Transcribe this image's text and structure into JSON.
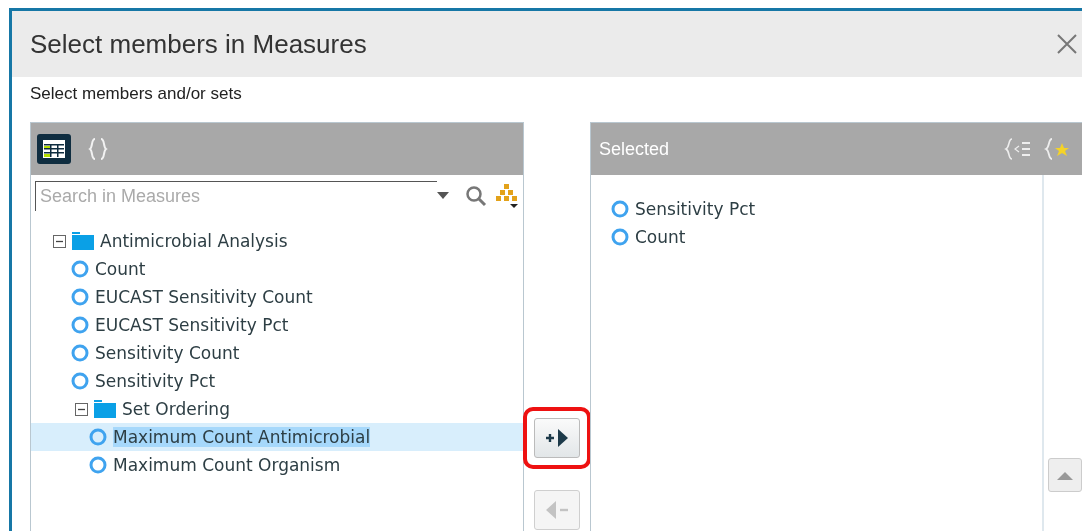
{
  "dialog": {
    "title": "Select members in Measures",
    "subtitle": "Select members and/or sets"
  },
  "left_panel": {
    "search": {
      "placeholder": "Search in Measures"
    },
    "tree": [
      {
        "kind": "folder",
        "label": "Antimicrobial Analysis",
        "expanded": true,
        "children": [
          {
            "kind": "member",
            "label": "Count",
            "selected": false
          },
          {
            "kind": "member",
            "label": "EUCAST Sensitivity Count",
            "selected": false
          },
          {
            "kind": "member",
            "label": "EUCAST Sensitivity Pct",
            "selected": false
          },
          {
            "kind": "member",
            "label": "Sensitivity Count",
            "selected": false
          },
          {
            "kind": "member",
            "label": "Sensitivity Pct",
            "selected": false
          },
          {
            "kind": "folder",
            "label": "Set Ordering",
            "expanded": true,
            "children": [
              {
                "kind": "member",
                "label": "Maximum Count Antimicrobial",
                "selected": true
              },
              {
                "kind": "member",
                "label": "Maximum Count Organism",
                "selected": false
              }
            ]
          }
        ]
      }
    ]
  },
  "move_buttons": [
    {
      "kind": "add",
      "disabled": false,
      "highlighted": true
    },
    {
      "kind": "remove",
      "disabled": true,
      "highlighted": false
    }
  ],
  "right_panel": {
    "title": "Selected",
    "items": [
      {
        "label": "Sensitivity Pct"
      },
      {
        "label": "Count"
      }
    ]
  }
}
